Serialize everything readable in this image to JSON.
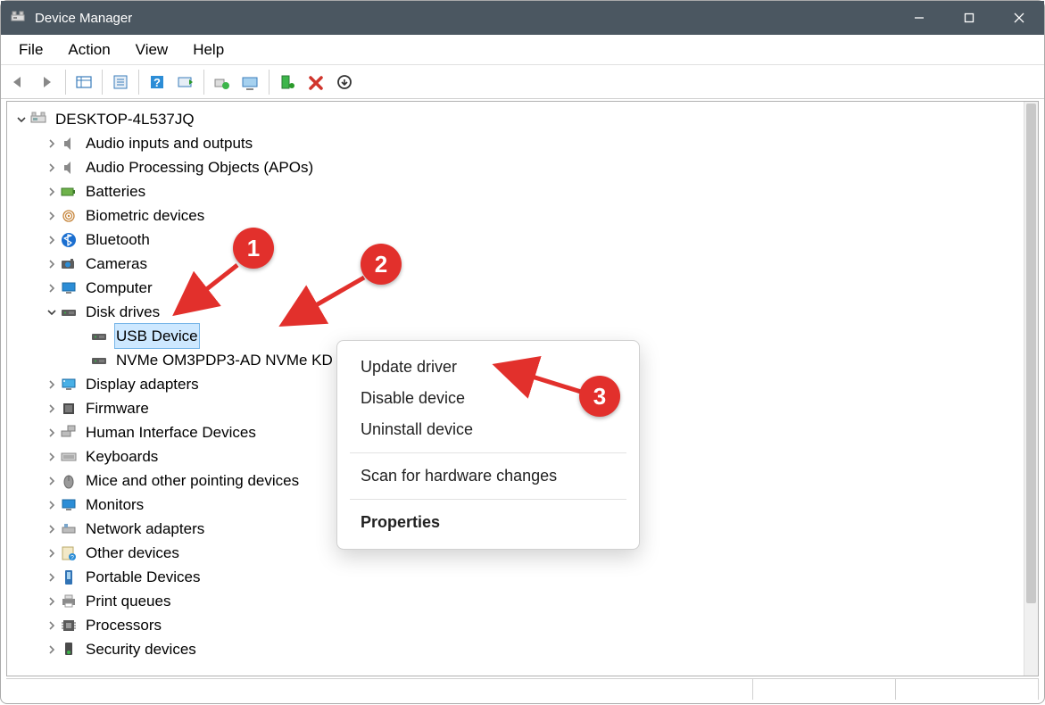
{
  "window": {
    "title": "Device Manager"
  },
  "menubar": [
    "File",
    "Action",
    "View",
    "Help"
  ],
  "root_name": "DESKTOP-4L537JQ",
  "tree": [
    {
      "label": "Audio inputs and outputs",
      "icon": "speaker-icon",
      "expanded": false,
      "level": 1
    },
    {
      "label": "Audio Processing Objects (APOs)",
      "icon": "speaker-icon",
      "expanded": false,
      "level": 1
    },
    {
      "label": "Batteries",
      "icon": "battery-icon",
      "expanded": false,
      "level": 1
    },
    {
      "label": "Biometric devices",
      "icon": "biometric-icon",
      "expanded": false,
      "level": 1
    },
    {
      "label": "Bluetooth",
      "icon": "bluetooth-icon",
      "expanded": false,
      "level": 1
    },
    {
      "label": "Cameras",
      "icon": "camera-icon",
      "expanded": false,
      "level": 1
    },
    {
      "label": "Computer",
      "icon": "computer-icon",
      "expanded": false,
      "level": 1
    },
    {
      "label": "Disk drives",
      "icon": "disk-icon",
      "expanded": true,
      "level": 1
    },
    {
      "label": "USB Device",
      "prefix_hidden": "                                          ",
      "icon": "hdd-icon",
      "expanded": null,
      "level": 2,
      "selected": true
    },
    {
      "label": "NVMe OM3PDP3-AD NVMe KD",
      "icon": "hdd-icon",
      "expanded": null,
      "level": 2
    },
    {
      "label": "Display adapters",
      "icon": "display-icon",
      "expanded": false,
      "level": 1
    },
    {
      "label": "Firmware",
      "icon": "firmware-icon",
      "expanded": false,
      "level": 1
    },
    {
      "label": "Human Interface Devices",
      "icon": "hid-icon",
      "expanded": false,
      "level": 1
    },
    {
      "label": "Keyboards",
      "icon": "keyboard-icon",
      "expanded": false,
      "level": 1
    },
    {
      "label": "Mice and other pointing devices",
      "icon": "mouse-icon",
      "expanded": false,
      "level": 1
    },
    {
      "label": "Monitors",
      "icon": "monitor-icon",
      "expanded": false,
      "level": 1
    },
    {
      "label": "Network adapters",
      "icon": "network-icon",
      "expanded": false,
      "level": 1
    },
    {
      "label": "Other devices",
      "icon": "other-icon",
      "expanded": false,
      "level": 1
    },
    {
      "label": "Portable Devices",
      "icon": "portable-icon",
      "expanded": false,
      "level": 1
    },
    {
      "label": "Print queues",
      "icon": "printer-icon",
      "expanded": false,
      "level": 1
    },
    {
      "label": "Processors",
      "icon": "processor-icon",
      "expanded": false,
      "level": 1
    },
    {
      "label": "Security devices",
      "icon": "security-icon",
      "expanded": false,
      "level": 1
    }
  ],
  "context_menu": {
    "items": [
      {
        "label": "Update driver",
        "kind": "item"
      },
      {
        "label": "Disable device",
        "kind": "item"
      },
      {
        "label": "Uninstall device",
        "kind": "item"
      },
      {
        "kind": "sep"
      },
      {
        "label": "Scan for hardware changes",
        "kind": "item"
      },
      {
        "kind": "sep"
      },
      {
        "label": "Properties",
        "kind": "item",
        "bold": true
      }
    ]
  },
  "annotations": {
    "badges": [
      {
        "num": "1"
      },
      {
        "num": "2"
      },
      {
        "num": "3"
      }
    ]
  }
}
